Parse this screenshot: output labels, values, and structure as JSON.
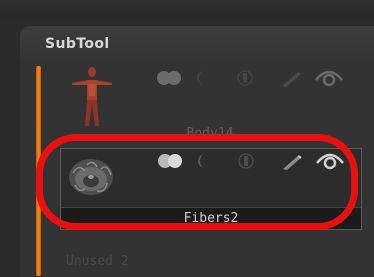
{
  "panel": {
    "title": "SubTool"
  },
  "subtools": [
    {
      "name": "Body14",
      "thumbnail": "human-figure-icon",
      "selected": false,
      "icons": [
        "visibility-toggle-icon",
        "moon-icon",
        "dim-circle-icon",
        "brush-icon",
        "eye-icon"
      ]
    },
    {
      "name": "Fibers2",
      "thumbnail": "fiber-mesh-icon",
      "selected": true,
      "icons": [
        "visibility-toggle-icon",
        "moon-icon",
        "dim-circle-icon",
        "brush-icon",
        "eye-icon"
      ]
    },
    {
      "name": "Unused 2",
      "partially_visible": true
    }
  ],
  "colors": {
    "accent_bar": "#ff8a1a",
    "highlight": "#e81010",
    "panel_bg": "#333333"
  }
}
